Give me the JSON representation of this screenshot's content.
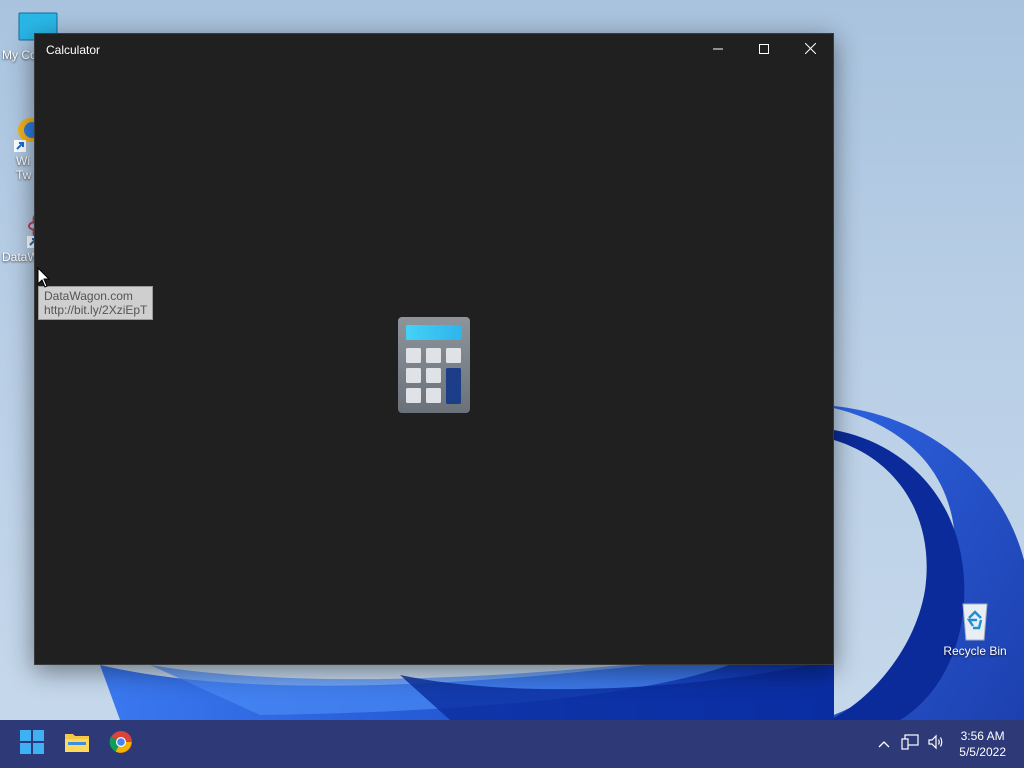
{
  "desktop": {
    "icons": [
      {
        "label": "My Co"
      },
      {
        "label_line1": "Wi",
        "label_line2": "Tw"
      },
      {
        "label": "DataW"
      },
      {
        "label": "Recycle Bin"
      }
    ]
  },
  "window": {
    "title": "Calculator",
    "splash_icon": "calculator-icon"
  },
  "tooltip": {
    "line1": "DataWagon.com",
    "line2": "http://bit.ly/2XziEpT"
  },
  "taskbar": {
    "items": [
      "windows-start-icon",
      "file-explorer-icon",
      "chrome-icon"
    ],
    "tray": [
      "chevron-up-icon",
      "network-icon",
      "volume-icon"
    ],
    "time": "3:56 AM",
    "date": "5/5/2022"
  },
  "colors": {
    "window_bg": "#202020",
    "taskbar_bg": "#2e3a78",
    "accent": "#1a5fd4"
  }
}
